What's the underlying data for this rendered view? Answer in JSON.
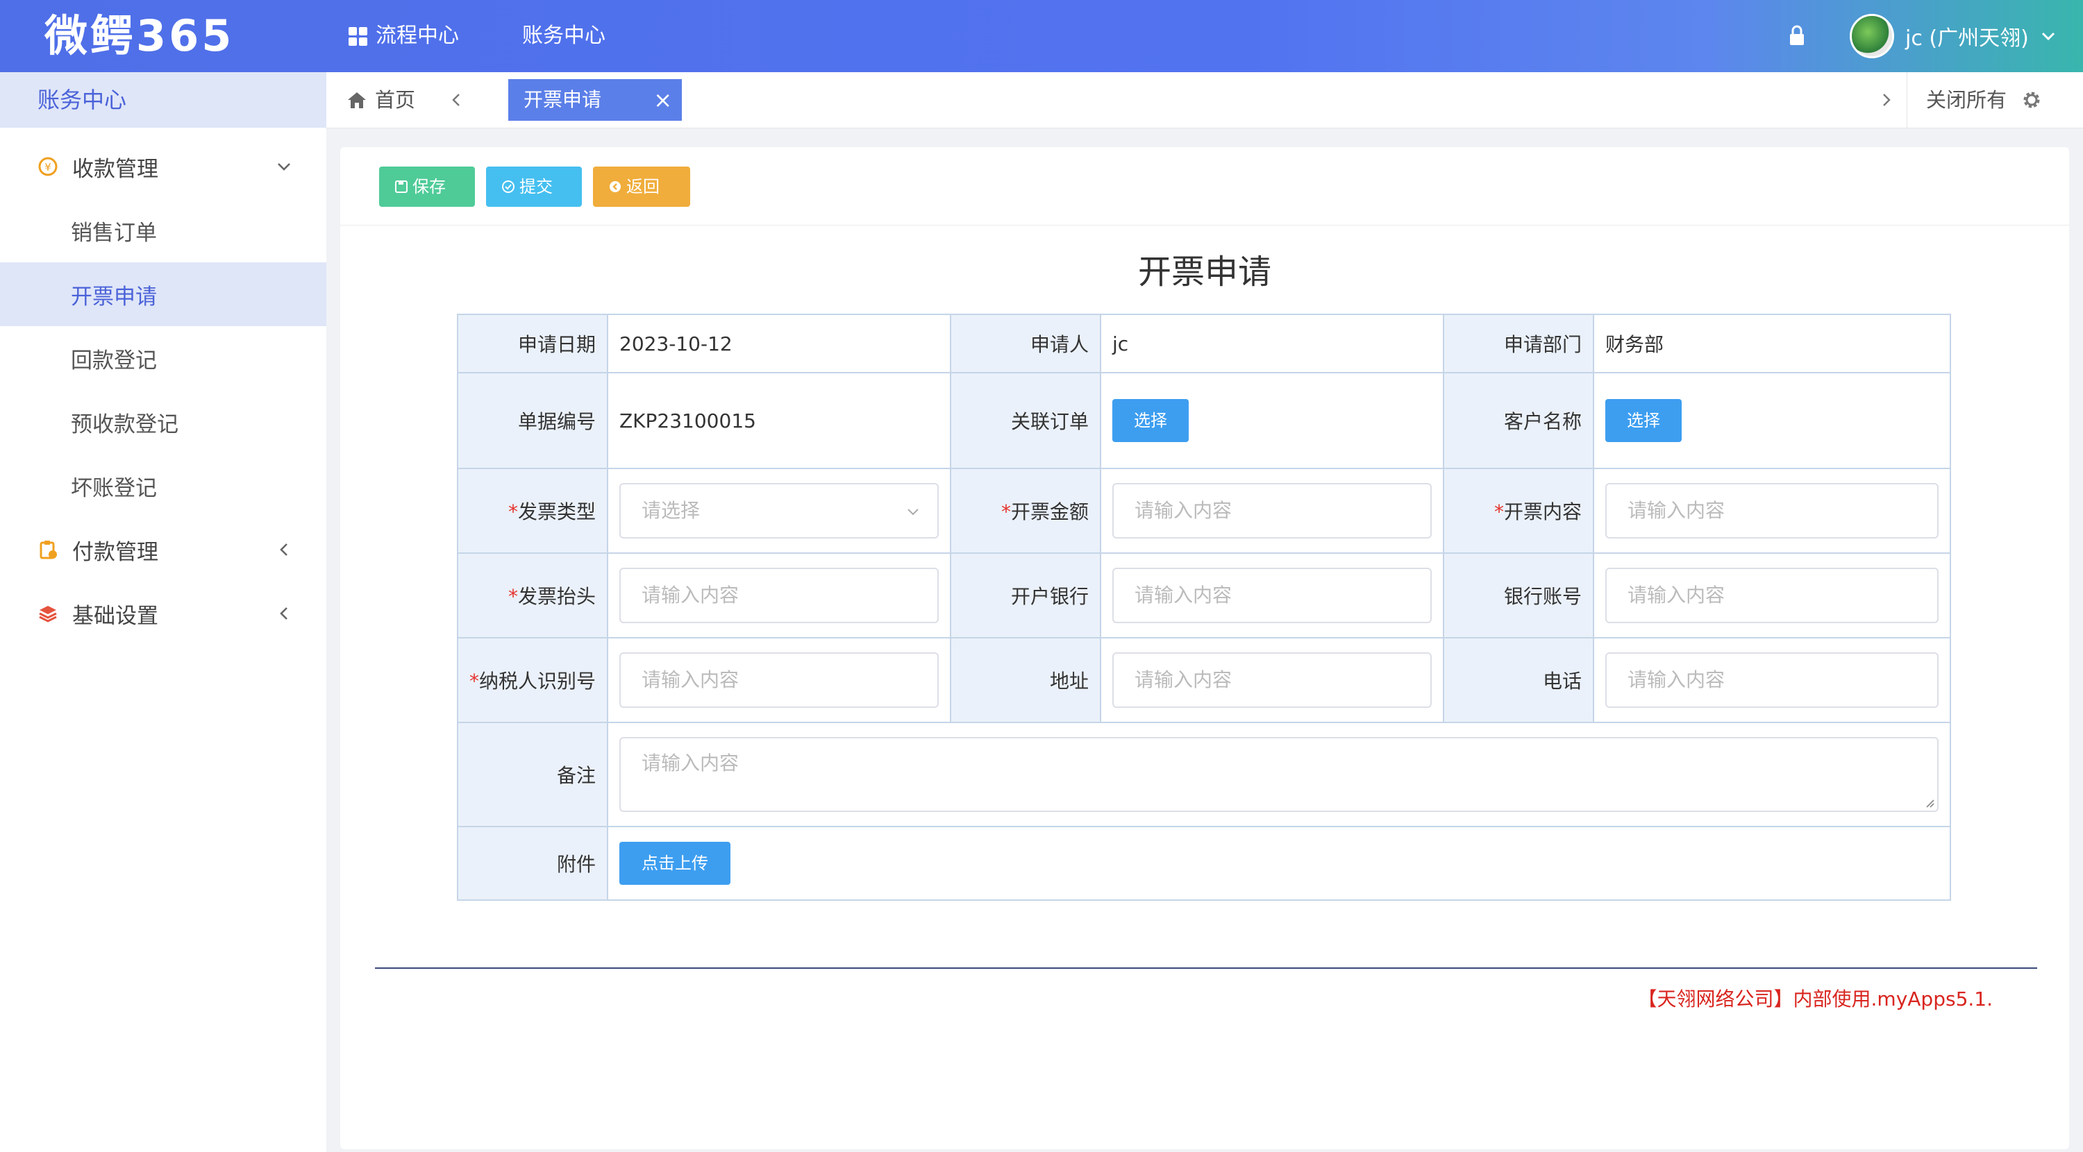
{
  "app": {
    "logo": "微鳄365"
  },
  "topnav": {
    "flow_center": "流程中心",
    "finance_center": "账务中心"
  },
  "user": {
    "name": "jc (广州天翎)"
  },
  "sidebar": {
    "section": "账务中心",
    "items": [
      {
        "label": "收款管理",
        "icon": "coin-icon",
        "expanded": true
      },
      {
        "label": "销售订单"
      },
      {
        "label": "开票申请",
        "active": true
      },
      {
        "label": "回款登记"
      },
      {
        "label": "预收款登记"
      },
      {
        "label": "坏账登记"
      },
      {
        "label": "付款管理",
        "icon": "clipboard-icon",
        "expanded": false
      },
      {
        "label": "基础设置",
        "icon": "layers-icon",
        "expanded": false
      }
    ]
  },
  "tabs": {
    "home": "首页",
    "active": "开票申请",
    "close_glyph": "×",
    "close_all": "关闭所有"
  },
  "toolbar": {
    "save": "保存",
    "submit": "提交",
    "back": "返回"
  },
  "form": {
    "title": "开票申请",
    "apply_date_label": "申请日期",
    "apply_date": "2023-10-12",
    "applicant_label": "申请人",
    "applicant": "jc",
    "dept_label": "申请部门",
    "dept": "财务部",
    "doc_no_label": "单据编号",
    "doc_no": "ZKP23100015",
    "order_label": "关联订单",
    "order_btn": "选择",
    "customer_label": "客户名称",
    "customer_btn": "选择",
    "required_mark": "*",
    "invoice_type_label": "发票类型",
    "invoice_type_placeholder": "请选择",
    "amount_label": "开票金额",
    "amount_placeholder": "请输入内容",
    "content_label": "开票内容",
    "content_placeholder": "请输入内容",
    "header_label": "发票抬头",
    "header_placeholder": "请输入内容",
    "bank_label": "开户银行",
    "bank_placeholder": "请输入内容",
    "account_label": "银行账号",
    "account_placeholder": "请输入内容",
    "taxid_label": "纳税人识别号",
    "taxid_placeholder": "请输入内容",
    "address_label": "地址",
    "address_placeholder": "请输入内容",
    "phone_label": "电话",
    "phone_placeholder": "请输入内容",
    "remark_label": "备注",
    "remark_placeholder": "请输入内容",
    "attach_label": "附件",
    "upload_btn": "点击上传"
  },
  "footer": {
    "text": "【天翎网络公司】内部使用.myApps5.1."
  },
  "colors": {
    "accent": "#4b62d8",
    "save": "#4fcb98",
    "submit": "#45bff0",
    "back": "#f0ad3c",
    "select": "#3d9ef0"
  }
}
